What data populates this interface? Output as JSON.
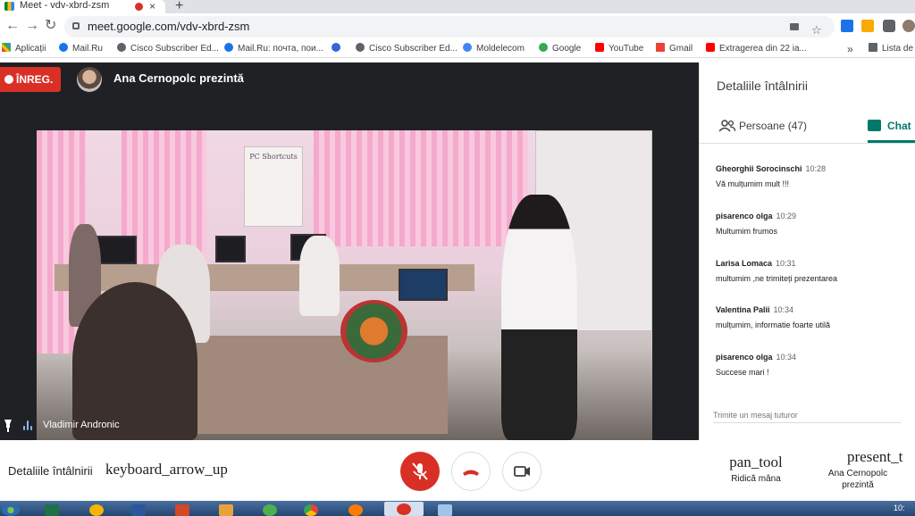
{
  "browser": {
    "tab_title": "Meet - vdv-xbrd-zsm",
    "tab_close": "×",
    "new_tab": "+",
    "url": "meet.google.com/vdv-xbrd-zsm",
    "back": "←",
    "forward": "→",
    "reload": "↻",
    "star": "☆",
    "bookmarks": [
      {
        "label": "Aplicații",
        "color": "#ea4335"
      },
      {
        "label": "Mail.Ru",
        "color": "#1a73e8"
      },
      {
        "label": "Cisco Subscriber Ed...",
        "color": "#5f6368"
      },
      {
        "label": "Mail.Ru: почта, пои...",
        "color": "#1a73e8"
      },
      {
        "label": "",
        "color": "#3367d6"
      },
      {
        "label": "Cisco Subscriber Ed...",
        "color": "#5f6368"
      },
      {
        "label": "Moldelecom",
        "color": "#4285f4"
      },
      {
        "label": "Google",
        "color": "#34a853"
      },
      {
        "label": "YouTube",
        "color": "#ff0000"
      },
      {
        "label": "Gmail",
        "color": "#ea4335"
      },
      {
        "label": "Extragerea din 22 ia...",
        "color": "#ff0000"
      }
    ],
    "bookmarks_more": "»",
    "reading_list": "Lista de"
  },
  "meet": {
    "rec_label": "ÎNREG.",
    "presenter_label": "Ana Cernopolc prezintă",
    "speaker_name": "Vladimir Andronic",
    "panel": {
      "title": "Detaliile întâlnirii",
      "people_tab": "Persoane (47)",
      "chat_tab": "Chat",
      "messages": [
        {
          "sender": "Gheorghii Sorocinschi",
          "time": "10:28",
          "text": "Vă mulțumim mult !!!"
        },
        {
          "sender": "pisarenco olga",
          "time": "10:29",
          "text": "Multumim frumos"
        },
        {
          "sender": "Larisa Lomaca",
          "time": "10:31",
          "text": "multumim ,ne trimiteți prezentarea"
        },
        {
          "sender": "Valentina Palii",
          "time": "10:34",
          "text": "mulțumim, informatie  foarte utilă"
        },
        {
          "sender": "pisarenco olga",
          "time": "10:34",
          "text": "Succese mari !"
        }
      ],
      "input_placeholder": "Trimite un mesaj tuturor"
    },
    "bottom": {
      "details_label": "Detaliile întâlnirii",
      "details_icon_text": "keyboard_arrow_up",
      "raise_hand_icon_text": "pan_tool",
      "raise_hand_label": "Ridică mâna",
      "present_icon_text": "present_t",
      "present_label": "Ana Cernopolc prezintă"
    }
  },
  "video_scene": {
    "poster_text": "PC Shortcuts"
  },
  "taskbar": {
    "clock": "10:"
  },
  "colors": {
    "rec_red": "#d93025",
    "chat_green": "#00796b",
    "stage_bg": "#202124"
  }
}
